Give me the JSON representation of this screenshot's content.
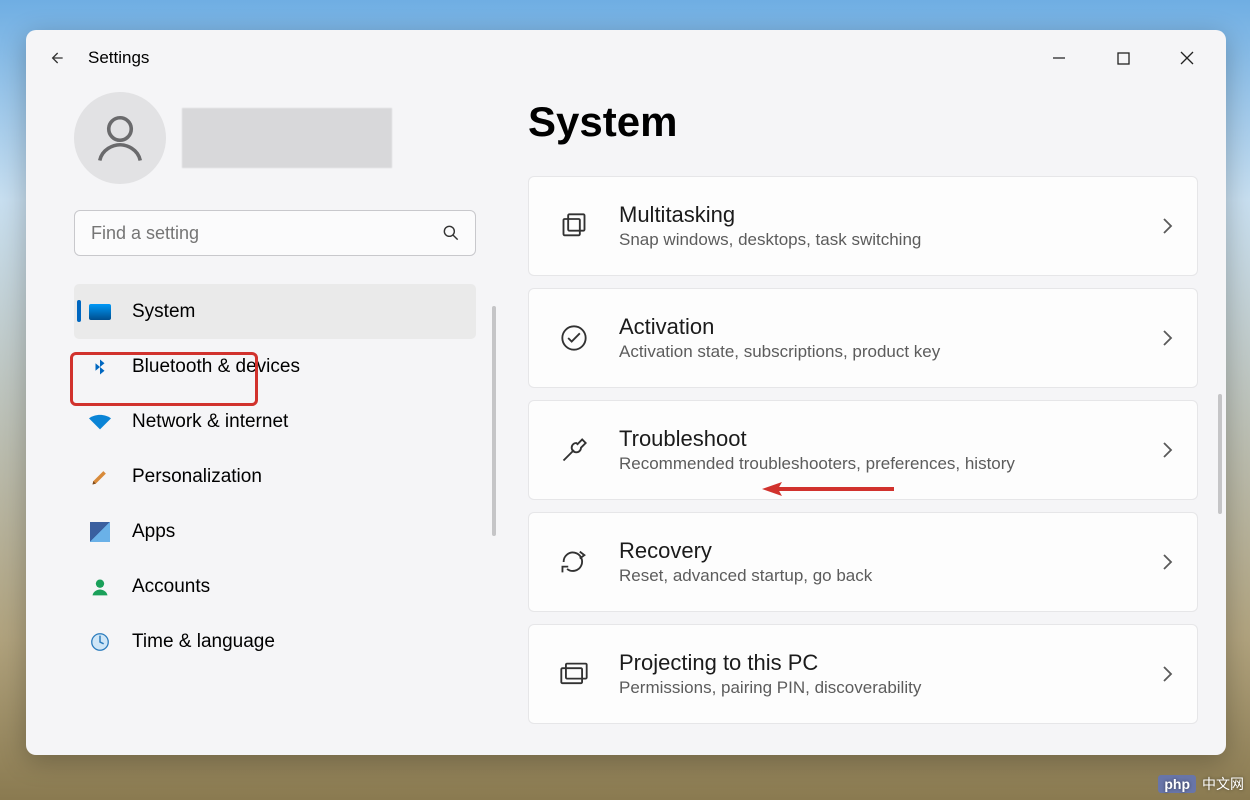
{
  "app": {
    "title": "Settings"
  },
  "search": {
    "placeholder": "Find a setting"
  },
  "sidebar": {
    "items": [
      {
        "label": "System"
      },
      {
        "label": "Bluetooth & devices"
      },
      {
        "label": "Network & internet"
      },
      {
        "label": "Personalization"
      },
      {
        "label": "Apps"
      },
      {
        "label": "Accounts"
      },
      {
        "label": "Time & language"
      }
    ]
  },
  "page": {
    "title": "System"
  },
  "cards": [
    {
      "title": "Multitasking",
      "sub": "Snap windows, desktops, task switching"
    },
    {
      "title": "Activation",
      "sub": "Activation state, subscriptions, product key"
    },
    {
      "title": "Troubleshoot",
      "sub": "Recommended troubleshooters, preferences, history"
    },
    {
      "title": "Recovery",
      "sub": "Reset, advanced startup, go back"
    },
    {
      "title": "Projecting to this PC",
      "sub": "Permissions, pairing PIN, discoverability"
    }
  ],
  "watermark": {
    "tag": "php",
    "text": "中文网"
  }
}
